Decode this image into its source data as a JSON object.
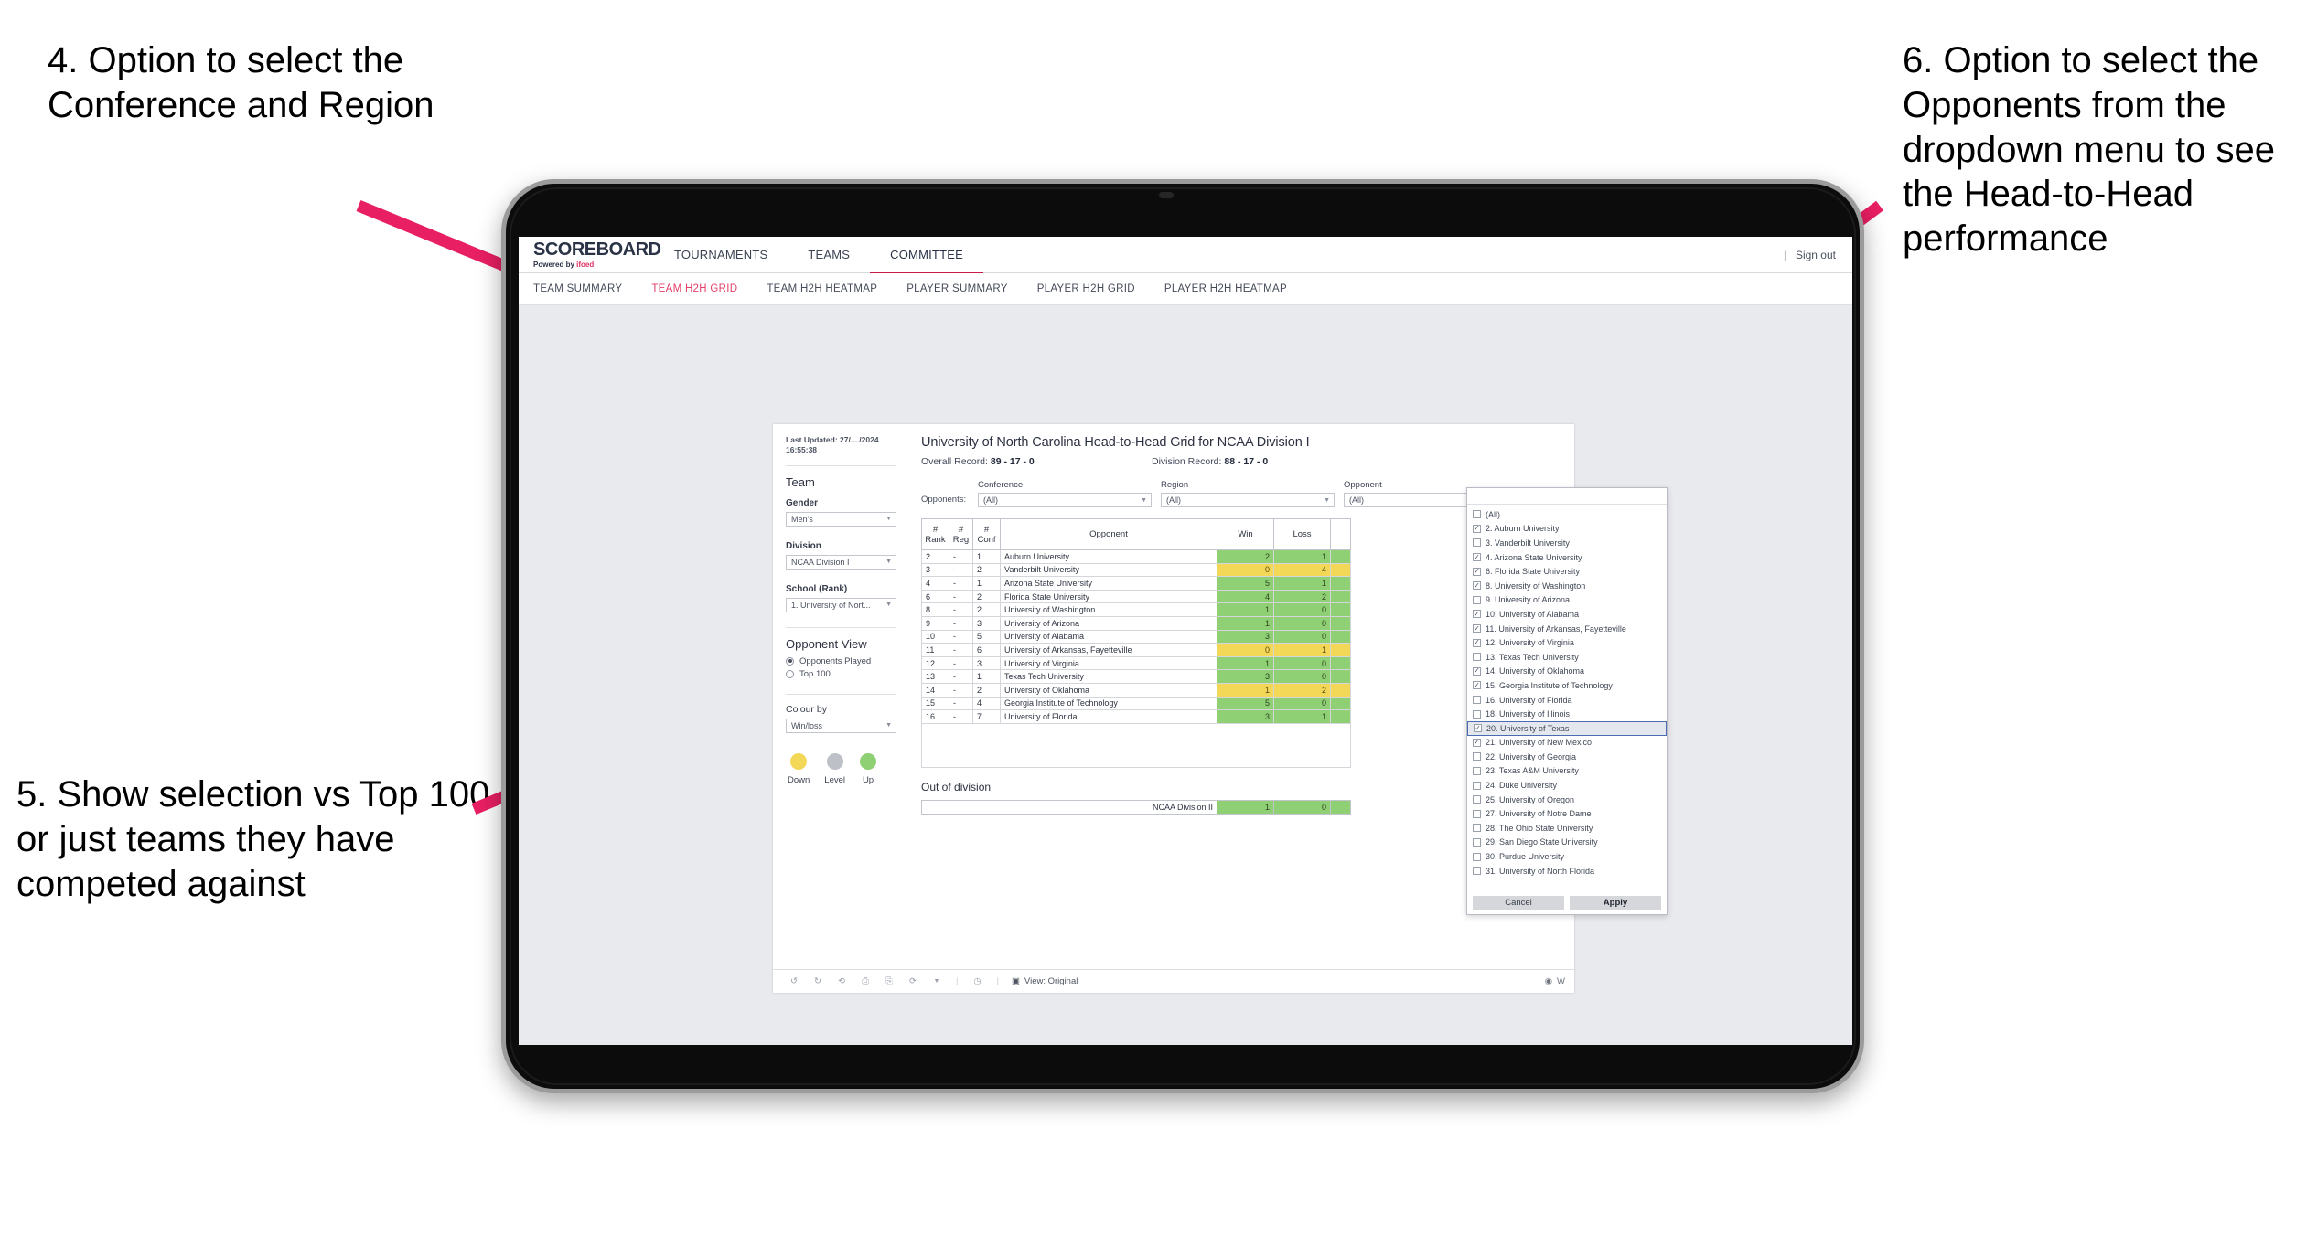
{
  "annotations": [
    {
      "id": "4",
      "text": "4. Option to select the Conference and Region"
    },
    {
      "id": "5",
      "text": "5. Show selection vs Top 100 or just teams they have competed against"
    },
    {
      "id": "6",
      "text": "6. Option to select the Opponents from the dropdown menu to see the Head-to-Head performance"
    }
  ],
  "colors": {
    "arrow": "#e81f63",
    "accent": "#c9184a",
    "tab_active": "#e2406b",
    "up": "#8ed073",
    "down": "#f3d756",
    "level": "#bdc0c6"
  },
  "app": {
    "logo": {
      "word": "SCOREBOARD",
      "sub_prefix": "Powered by ",
      "sub_accent": "ifoed"
    },
    "topnav": [
      {
        "label": "TOURNAMENTS",
        "active": false
      },
      {
        "label": "TEAMS",
        "active": false
      },
      {
        "label": "COMMITTEE",
        "active": true
      }
    ],
    "signout": {
      "separator": "|",
      "label": "Sign out"
    },
    "subnav": [
      {
        "label": "TEAM SUMMARY",
        "active": false
      },
      {
        "label": "TEAM H2H GRID",
        "active": true
      },
      {
        "label": "TEAM H2H HEATMAP",
        "active": false
      },
      {
        "label": "PLAYER SUMMARY",
        "active": false
      },
      {
        "label": "PLAYER H2H GRID",
        "active": false
      },
      {
        "label": "PLAYER H2H HEATMAP",
        "active": false
      }
    ]
  },
  "sidebar": {
    "last_updated_line1": "Last Updated: 27/..../2024",
    "last_updated_line2": "16:55:38",
    "team_heading": "Team",
    "gender_label": "Gender",
    "gender_value": "Men's",
    "division_label": "Division",
    "division_value": "NCAA Division I",
    "school_label": "School (Rank)",
    "school_value": "1. University of Nort...",
    "opponent_view_heading": "Opponent View",
    "opponent_view_options": [
      {
        "label": "Opponents Played",
        "selected": true
      },
      {
        "label": "Top 100",
        "selected": false
      }
    ],
    "colour_by_label": "Colour by",
    "colour_by_value": "Win/loss",
    "legend": [
      {
        "label": "Down",
        "color": "#f3d756"
      },
      {
        "label": "Level",
        "color": "#bdc0c6"
      },
      {
        "label": "Up",
        "color": "#8ed073"
      }
    ]
  },
  "main": {
    "title": "University of North Carolina Head-to-Head Grid for NCAA Division I",
    "overall_record_label": "Overall Record: ",
    "overall_record_value": "89 - 17 - 0",
    "division_record_label": "Division Record: ",
    "division_record_value": "88 - 17 - 0",
    "opponents_label": "Opponents:",
    "filters": [
      {
        "name": "conference",
        "label": "Conference",
        "value": "(All)"
      },
      {
        "name": "region",
        "label": "Region",
        "value": "(All)"
      },
      {
        "name": "opponent",
        "label": "Opponent",
        "value": "(All)"
      }
    ],
    "out_of_division_title": "Out of division",
    "out_of_division_row": {
      "label": "NCAA Division II",
      "win": "1",
      "loss": "0",
      "state": "up"
    }
  },
  "chart_data": {
    "type": "table",
    "title": "University of North Carolina Head-to-Head Grid for NCAA Division I",
    "columns": [
      "# Rank",
      "# Reg",
      "# Conf",
      "Opponent",
      "Win",
      "Loss"
    ],
    "rows": [
      {
        "rank": "2",
        "reg": "-",
        "conf": "1",
        "opponent": "Auburn University",
        "win": "2",
        "loss": "1",
        "state": "up"
      },
      {
        "rank": "3",
        "reg": "-",
        "conf": "2",
        "opponent": "Vanderbilt University",
        "win": "0",
        "loss": "4",
        "state": "down"
      },
      {
        "rank": "4",
        "reg": "-",
        "conf": "1",
        "opponent": "Arizona State University",
        "win": "5",
        "loss": "1",
        "state": "up"
      },
      {
        "rank": "6",
        "reg": "-",
        "conf": "2",
        "opponent": "Florida State University",
        "win": "4",
        "loss": "2",
        "state": "up"
      },
      {
        "rank": "8",
        "reg": "-",
        "conf": "2",
        "opponent": "University of Washington",
        "win": "1",
        "loss": "0",
        "state": "up"
      },
      {
        "rank": "9",
        "reg": "-",
        "conf": "3",
        "opponent": "University of Arizona",
        "win": "1",
        "loss": "0",
        "state": "up"
      },
      {
        "rank": "10",
        "reg": "-",
        "conf": "5",
        "opponent": "University of Alabama",
        "win": "3",
        "loss": "0",
        "state": "up"
      },
      {
        "rank": "11",
        "reg": "-",
        "conf": "6",
        "opponent": "University of Arkansas, Fayetteville",
        "win": "0",
        "loss": "1",
        "state": "down"
      },
      {
        "rank": "12",
        "reg": "-",
        "conf": "3",
        "opponent": "University of Virginia",
        "win": "1",
        "loss": "0",
        "state": "up"
      },
      {
        "rank": "13",
        "reg": "-",
        "conf": "1",
        "opponent": "Texas Tech University",
        "win": "3",
        "loss": "0",
        "state": "up"
      },
      {
        "rank": "14",
        "reg": "-",
        "conf": "2",
        "opponent": "University of Oklahoma",
        "win": "1",
        "loss": "2",
        "state": "down"
      },
      {
        "rank": "15",
        "reg": "-",
        "conf": "4",
        "opponent": "Georgia Institute of Technology",
        "win": "5",
        "loss": "0",
        "state": "up"
      },
      {
        "rank": "16",
        "reg": "-",
        "conf": "7",
        "opponent": "University of Florida",
        "win": "3",
        "loss": "1",
        "state": "up"
      }
    ]
  },
  "opponent_dropdown": {
    "items": [
      {
        "label": "(All)",
        "checked": false,
        "highlighted": false
      },
      {
        "label": "2. Auburn University",
        "checked": true,
        "highlighted": false
      },
      {
        "label": "3. Vanderbilt University",
        "checked": false,
        "highlighted": false
      },
      {
        "label": "4. Arizona State University",
        "checked": true,
        "highlighted": false
      },
      {
        "label": "6. Florida State University",
        "checked": true,
        "highlighted": false
      },
      {
        "label": "8. University of Washington",
        "checked": true,
        "highlighted": false
      },
      {
        "label": "9. University of Arizona",
        "checked": false,
        "highlighted": false
      },
      {
        "label": "10. University of Alabama",
        "checked": true,
        "highlighted": false
      },
      {
        "label": "11. University of Arkansas, Fayetteville",
        "checked": true,
        "highlighted": false
      },
      {
        "label": "12. University of Virginia",
        "checked": true,
        "highlighted": false
      },
      {
        "label": "13. Texas Tech University",
        "checked": false,
        "highlighted": false
      },
      {
        "label": "14. University of Oklahoma",
        "checked": true,
        "highlighted": false
      },
      {
        "label": "15. Georgia Institute of Technology",
        "checked": true,
        "highlighted": false
      },
      {
        "label": "16. University of Florida",
        "checked": false,
        "highlighted": false
      },
      {
        "label": "18. University of Illinois",
        "checked": false,
        "highlighted": false
      },
      {
        "label": "20. University of Texas",
        "checked": true,
        "highlighted": true
      },
      {
        "label": "21. University of New Mexico",
        "checked": true,
        "highlighted": false
      },
      {
        "label": "22. University of Georgia",
        "checked": false,
        "highlighted": false
      },
      {
        "label": "23. Texas A&M University",
        "checked": false,
        "highlighted": false
      },
      {
        "label": "24. Duke University",
        "checked": false,
        "highlighted": false
      },
      {
        "label": "25. University of Oregon",
        "checked": false,
        "highlighted": false
      },
      {
        "label": "27. University of Notre Dame",
        "checked": false,
        "highlighted": false
      },
      {
        "label": "28. The Ohio State University",
        "checked": false,
        "highlighted": false
      },
      {
        "label": "29. San Diego State University",
        "checked": false,
        "highlighted": false
      },
      {
        "label": "30. Purdue University",
        "checked": false,
        "highlighted": false
      },
      {
        "label": "31. University of North Florida",
        "checked": false,
        "highlighted": false
      }
    ],
    "cancel_label": "Cancel",
    "apply_label": "Apply"
  },
  "toolbar": {
    "view_label": "View: Original",
    "right_label": "W"
  }
}
